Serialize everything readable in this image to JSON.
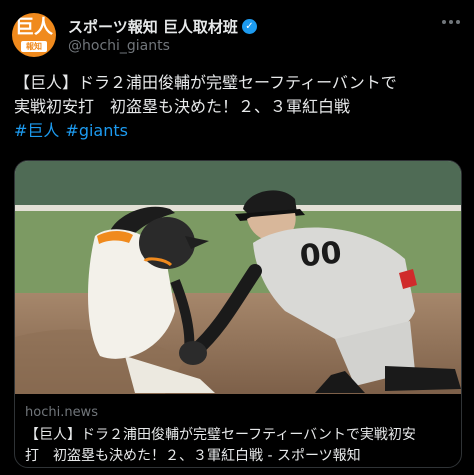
{
  "account": {
    "avatar_text": "巨人",
    "avatar_sub": "報知",
    "display_name": "スポーツ報知 巨人取材班",
    "verified_mark": "✓",
    "handle": "@hochi_giants"
  },
  "post": {
    "line1": "【巨人】ドラ２浦田俊輔が完璧セーフティーバントで",
    "line2": "実戦初安打　初盗塁も決めた！２、３軍紅白戦",
    "hashtags": [
      "#巨人",
      "#giants"
    ]
  },
  "link_card": {
    "domain": "hochi.news",
    "title_line1": "【巨人】ドラ２浦田俊輔が完璧セーフティーバントで実戦初安",
    "title_line2": "打　初盗塁も決めた！２、３軍紅白戦 - スポーツ報知",
    "image_jersey_number": "00"
  },
  "colors": {
    "accent": "#1d9bf0",
    "avatar_orange": "#f08a1d",
    "secondary_text": "#71767b"
  }
}
